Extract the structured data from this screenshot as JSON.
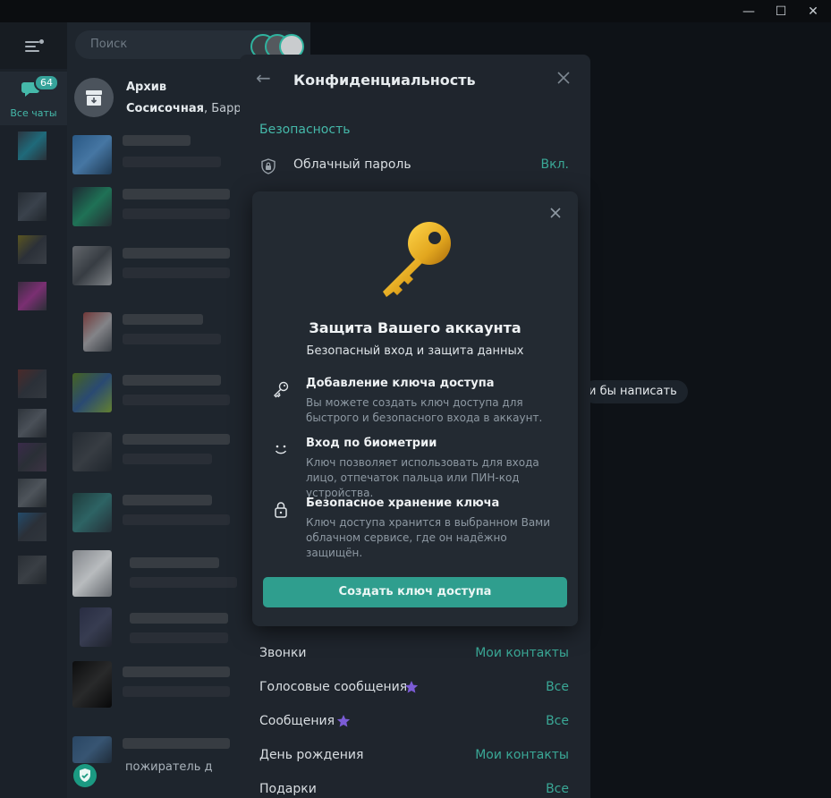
{
  "window": {
    "minimize": "—",
    "maximize": "☐",
    "close": "✕"
  },
  "sidebar": {
    "all_chats_label": "Все чаты",
    "all_chats_badge": "64"
  },
  "search": {
    "placeholder": "Поиск"
  },
  "archive": {
    "title": "Архив",
    "subtitle_bold": "Сосисочная",
    "subtitle_rest": ", Баррел"
  },
  "hint": {
    "text": "и бы написать"
  },
  "privacy": {
    "title": "Конфиденциальность",
    "security_header": "Безопасность",
    "cloud_password": {
      "label": "Облачный пароль",
      "value": "Вкл."
    },
    "rows": [
      {
        "label": "Звонки",
        "value": "Мои контакты",
        "premium": false
      },
      {
        "label": "Голосовые сообщения",
        "value": "Все",
        "premium": true
      },
      {
        "label": "Сообщения",
        "value": "Все",
        "premium": true
      },
      {
        "label": "День рождения",
        "value": "Мои контакты",
        "premium": false
      },
      {
        "label": "Подарки",
        "value": "Все",
        "premium": false
      }
    ]
  },
  "modal": {
    "title": "Защита Вашего аккаунта",
    "subtitle": "Безопасный вход и защита данных",
    "features": [
      {
        "icon": "key-outline-icon",
        "title": "Добавление ключа доступа",
        "desc": "Вы можете создать ключ доступа для быстрого и безопасного входа в аккаунт."
      },
      {
        "icon": "face-smile-icon",
        "title": "Вход по биометрии",
        "desc": "Ключ позволяет использовать для входа лицо, отпечаток пальца или ПИН-код устройства."
      },
      {
        "icon": "lock-icon",
        "title": "Безопасное хранение ключа",
        "desc": "Ключ доступа хранится в выбранном Вами облачном сервисе, где он надёжно защищён."
      }
    ],
    "cta": "Создать ключ доступа"
  },
  "bottom_chat": {
    "text": "пожиратель д"
  },
  "colors": {
    "accent": "#45b9aa",
    "button": "#2f9e8e",
    "premium_star": "#7b5cd6",
    "key_gold": "#e2a61e"
  }
}
